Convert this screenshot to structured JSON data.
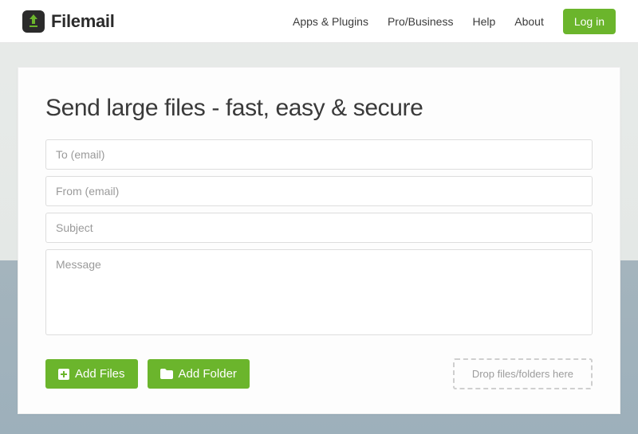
{
  "brand": {
    "name": "Filemail"
  },
  "nav": {
    "apps": "Apps & Plugins",
    "pro": "Pro/Business",
    "help": "Help",
    "about": "About",
    "login": "Log in"
  },
  "headline": "Send large files - fast, easy & secure",
  "form": {
    "to_placeholder": "To (email)",
    "from_placeholder": "From (email)",
    "subject_placeholder": "Subject",
    "message_placeholder": "Message"
  },
  "buttons": {
    "add_files": "Add Files",
    "add_folder": "Add Folder"
  },
  "dropzone": {
    "label": "Drop files/folders here"
  },
  "colors": {
    "accent": "#6bb52c"
  }
}
